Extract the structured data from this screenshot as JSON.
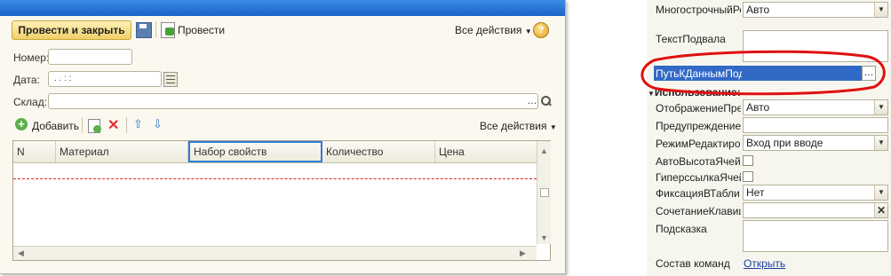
{
  "toolbar": {
    "post_close_label": "Провести и закрыть",
    "post_label": "Провести",
    "all_actions_label": "Все действия",
    "help_label": "?"
  },
  "fields": {
    "number_label": "Номер:",
    "date_label": "Дата:",
    "date_value": ". .    : :",
    "warehouse_label": "Склад:"
  },
  "table_toolbar": {
    "add_label": "Добавить",
    "all_actions_label": "Все действия"
  },
  "table": {
    "columns": [
      "N",
      "Материал",
      "Набор свойств",
      "Количество",
      "Цена"
    ]
  },
  "properties": {
    "multiline_label": "МногострочныйРе",
    "multiline_value": "Авто",
    "footer_text_label": "ТекстПодвала",
    "data_path_label": "ПутьКДаннымПод",
    "usage_section": "Использование:",
    "display_warning_label": "ОтображениеПред",
    "display_warning_value": "Авто",
    "warning_label": "ПредупреждениеП",
    "edit_mode_label": "РежимРедактиров",
    "edit_mode_value": "Вход при вводе",
    "auto_height_label": "АвтоВысотаЯчейк",
    "hyperlink_label": "ГиперссылкаЯчей",
    "fixation_label": "ФиксацияВТабли",
    "fixation_value": "Нет",
    "shortcut_label": "СочетаниеКлавиш",
    "tooltip_label": "Подсказка",
    "commands_label": "Состав команд",
    "commands_link": "Открыть"
  },
  "colors": {
    "highlight_red": "#e01010",
    "selection_blue": "#3169c6",
    "title_blue": "#2a72d8"
  }
}
